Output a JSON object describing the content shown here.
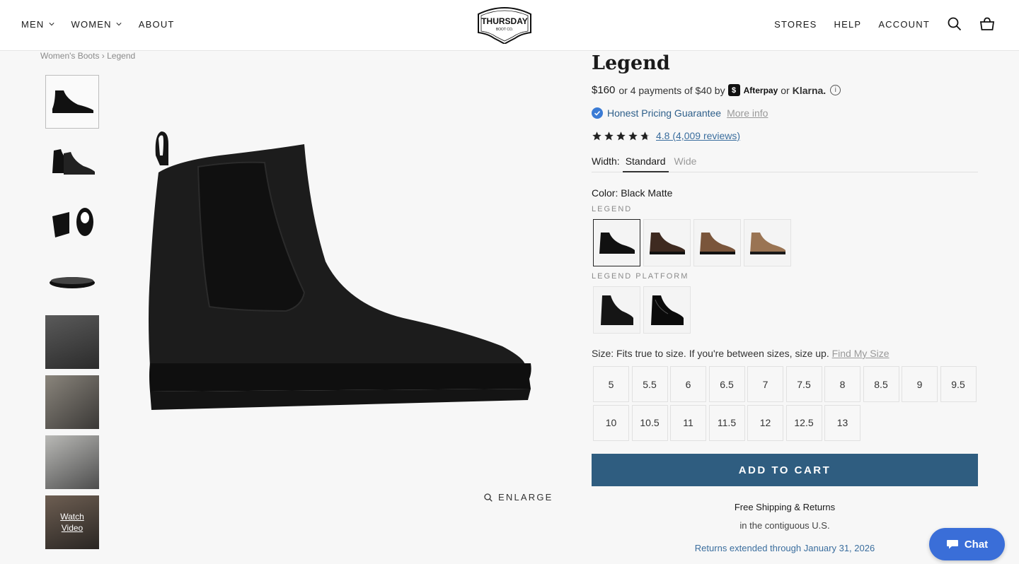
{
  "header": {
    "nav_left": [
      {
        "label": "MEN"
      },
      {
        "label": "WOMEN"
      },
      {
        "label": "ABOUT"
      }
    ],
    "logo_text": "THURSDAY BOOT CO.",
    "nav_right": [
      {
        "label": "STORES"
      },
      {
        "label": "HELP"
      },
      {
        "label": "ACCOUNT"
      }
    ]
  },
  "breadcrumb": {
    "parent": "Women's Boots",
    "separator": "›",
    "current": "Legend"
  },
  "gallery": {
    "watch_video_line1": "Watch",
    "watch_video_line2": "Video",
    "enlarge_label": "ENLARGE"
  },
  "product": {
    "title": "Legend",
    "price": "$160",
    "installments_text": "or 4 payments of $40 by",
    "afterpay_label": "Afterpay",
    "or_text": "or",
    "klarna_label": "Klarna.",
    "guarantee_text": "Honest Pricing Guarantee",
    "more_info": "More info",
    "rating": 4.8,
    "reviews_text": "4.8 (4,009 reviews)",
    "width_label": "Width:",
    "width_options": [
      {
        "label": "Standard",
        "selected": true
      },
      {
        "label": "Wide",
        "selected": false
      }
    ],
    "color_label": "Color:",
    "color_value": "Black Matte",
    "color_groups": [
      {
        "label": "LEGEND",
        "swatches": [
          "Black Matte",
          "Dark Brown",
          "Brown",
          "Tan"
        ]
      },
      {
        "label": "LEGEND PLATFORM",
        "swatches": [
          "Black Matte Platform",
          "Black Platform"
        ]
      }
    ],
    "size_label": "Size: Fits true to size. If you're between sizes, size up.",
    "find_size": "Find My Size",
    "sizes": [
      "5",
      "5.5",
      "6",
      "6.5",
      "7",
      "7.5",
      "8",
      "8.5",
      "9",
      "9.5",
      "10",
      "10.5",
      "11",
      "11.5",
      "12",
      "12.5",
      "13"
    ],
    "add_to_cart": "ADD TO CART",
    "shipping_title": "Free Shipping & Returns",
    "shipping_sub": "in the contiguous U.S.",
    "returns_text": "Returns extended through January 31, 2026"
  },
  "chat": {
    "label": "Chat"
  },
  "colors": {
    "accent": "#2f5d80",
    "link": "#3b6e9e",
    "chat": "#3a6ed8"
  }
}
